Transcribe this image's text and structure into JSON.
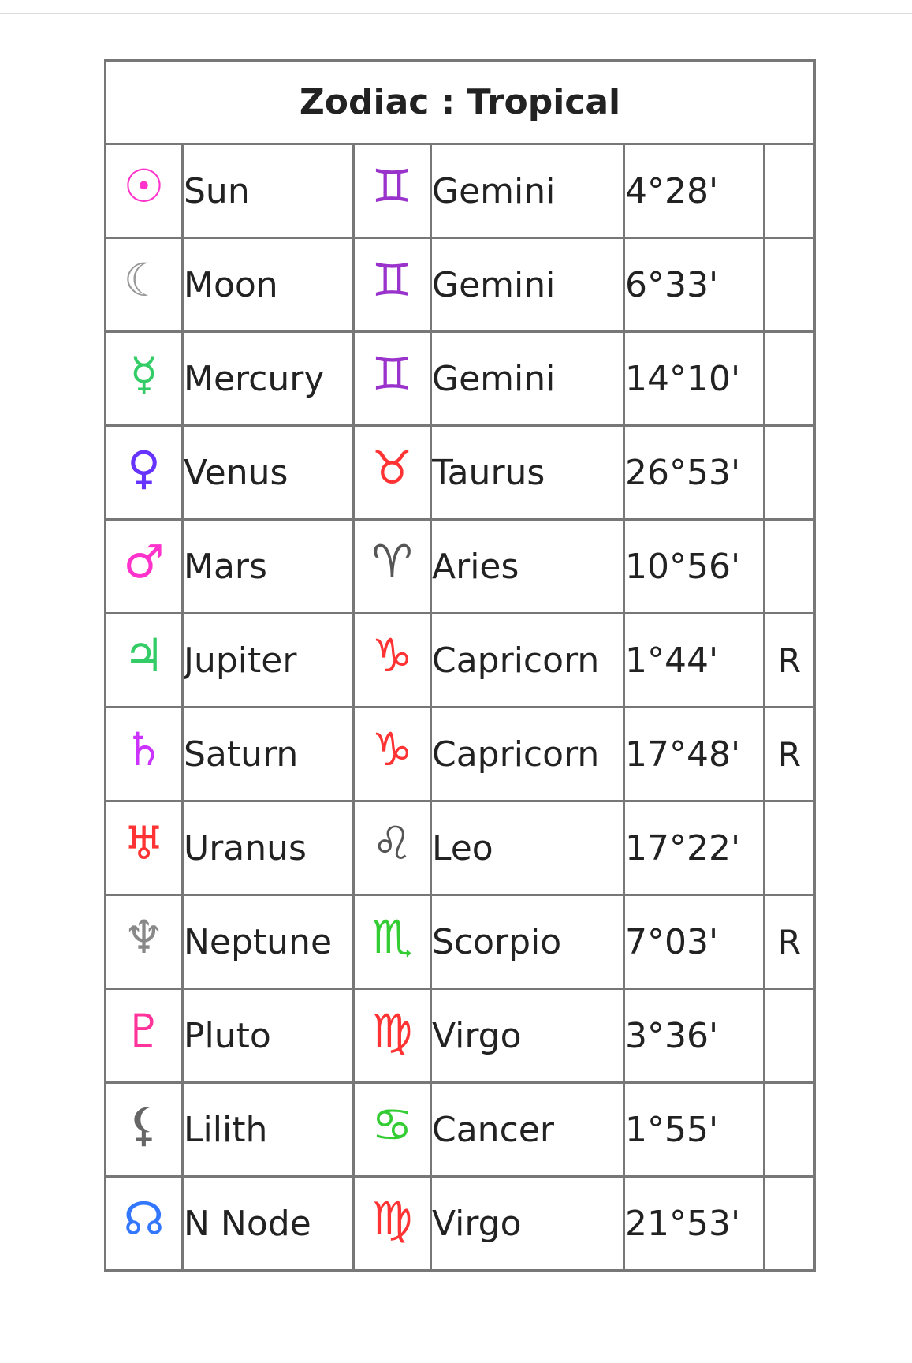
{
  "title": "Zodiac : Tropical",
  "rows": [
    {
      "planet": "Sun",
      "planet_symbol": "☉",
      "planet_icon": "sun-icon",
      "planet_color": "#ff33cc",
      "sign": "Gemini",
      "sign_symbol": "♊",
      "sign_icon": "gemini-icon",
      "sign_color": "#9933cc",
      "degree": "4°28'",
      "retro": ""
    },
    {
      "planet": "Moon",
      "planet_symbol": "☾",
      "planet_icon": "moon-icon",
      "planet_color": "#999999",
      "sign": "Gemini",
      "sign_symbol": "♊",
      "sign_icon": "gemini-icon",
      "sign_color": "#9933cc",
      "degree": "6°33'",
      "retro": ""
    },
    {
      "planet": "Mercury",
      "planet_symbol": "☿",
      "planet_icon": "mercury-icon",
      "planet_color": "#33cc66",
      "sign": "Gemini",
      "sign_symbol": "♊",
      "sign_icon": "gemini-icon",
      "sign_color": "#9933cc",
      "degree": "14°10'",
      "retro": ""
    },
    {
      "planet": "Venus",
      "planet_symbol": "♀",
      "planet_icon": "venus-icon",
      "planet_color": "#6633ff",
      "sign": "Taurus",
      "sign_symbol": "♉",
      "sign_icon": "taurus-icon",
      "sign_color": "#ff3333",
      "degree": "26°53'",
      "retro": ""
    },
    {
      "planet": "Mars",
      "planet_symbol": "♂",
      "planet_icon": "mars-icon",
      "planet_color": "#ff33cc",
      "sign": "Aries",
      "sign_symbol": "♈",
      "sign_icon": "aries-icon",
      "sign_color": "#555555",
      "degree": "10°56'",
      "retro": ""
    },
    {
      "planet": "Jupiter",
      "planet_symbol": "♃",
      "planet_icon": "jupiter-icon",
      "planet_color": "#33cc66",
      "sign": "Capricorn",
      "sign_symbol": "♑",
      "sign_icon": "capricorn-icon",
      "sign_color": "#ff3333",
      "degree": "1°44'",
      "retro": "R"
    },
    {
      "planet": "Saturn",
      "planet_symbol": "♄",
      "planet_icon": "saturn-icon",
      "planet_color": "#cc33ff",
      "sign": "Capricorn",
      "sign_symbol": "♑",
      "sign_icon": "capricorn-icon",
      "sign_color": "#ff3333",
      "degree": "17°48'",
      "retro": "R"
    },
    {
      "planet": "Uranus",
      "planet_symbol": "♅",
      "planet_icon": "uranus-icon",
      "planet_color": "#ff3333",
      "sign": "Leo",
      "sign_symbol": "♌",
      "sign_icon": "leo-icon",
      "sign_color": "#555555",
      "degree": "17°22'",
      "retro": ""
    },
    {
      "planet": "Neptune",
      "planet_symbol": "♆",
      "planet_icon": "neptune-icon",
      "planet_color": "#888888",
      "sign": "Scorpio",
      "sign_symbol": "♏",
      "sign_icon": "scorpio-icon",
      "sign_color": "#33cc33",
      "degree": "7°03'",
      "retro": "R"
    },
    {
      "planet": "Pluto",
      "planet_symbol": "♇",
      "planet_icon": "pluto-icon",
      "planet_color": "#ff3399",
      "sign": "Virgo",
      "sign_symbol": "♍",
      "sign_icon": "virgo-icon",
      "sign_color": "#ff3333",
      "degree": "3°36'",
      "retro": ""
    },
    {
      "planet": "Lilith",
      "planet_symbol": "⚸",
      "planet_icon": "lilith-icon",
      "planet_color": "#666666",
      "sign": "Cancer",
      "sign_symbol": "♋",
      "sign_icon": "cancer-icon",
      "sign_color": "#33cc33",
      "degree": "1°55'",
      "retro": ""
    },
    {
      "planet": "N Node",
      "planet_symbol": "☊",
      "planet_icon": "north-node-icon",
      "planet_color": "#3377ff",
      "sign": "Virgo",
      "sign_symbol": "♍",
      "sign_icon": "virgo-icon",
      "sign_color": "#ff3333",
      "degree": "21°53'",
      "retro": ""
    }
  ]
}
